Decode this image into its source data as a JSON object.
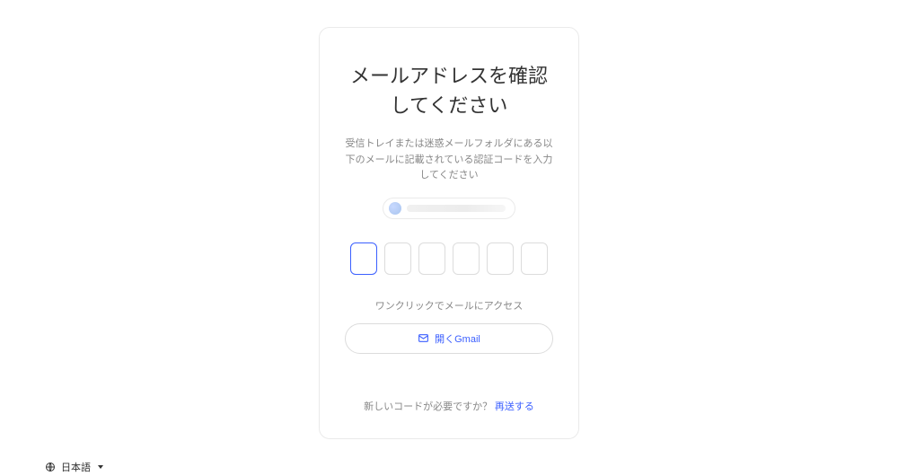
{
  "card": {
    "title": "メールアドレスを確認してください",
    "subtitle": "受信トレイまたは迷惑メールフォルダにある以下のメールに記載されている認証コードを入力してください",
    "code_inputs": [
      "",
      "",
      "",
      "",
      "",
      ""
    ],
    "oneclick_label": "ワンクリックでメールにアクセス",
    "gmail_button": "開くGmail",
    "resend_prompt": "新しいコードが必要ですか？",
    "resend_link": "再送する"
  },
  "footer": {
    "language": "日本語"
  }
}
